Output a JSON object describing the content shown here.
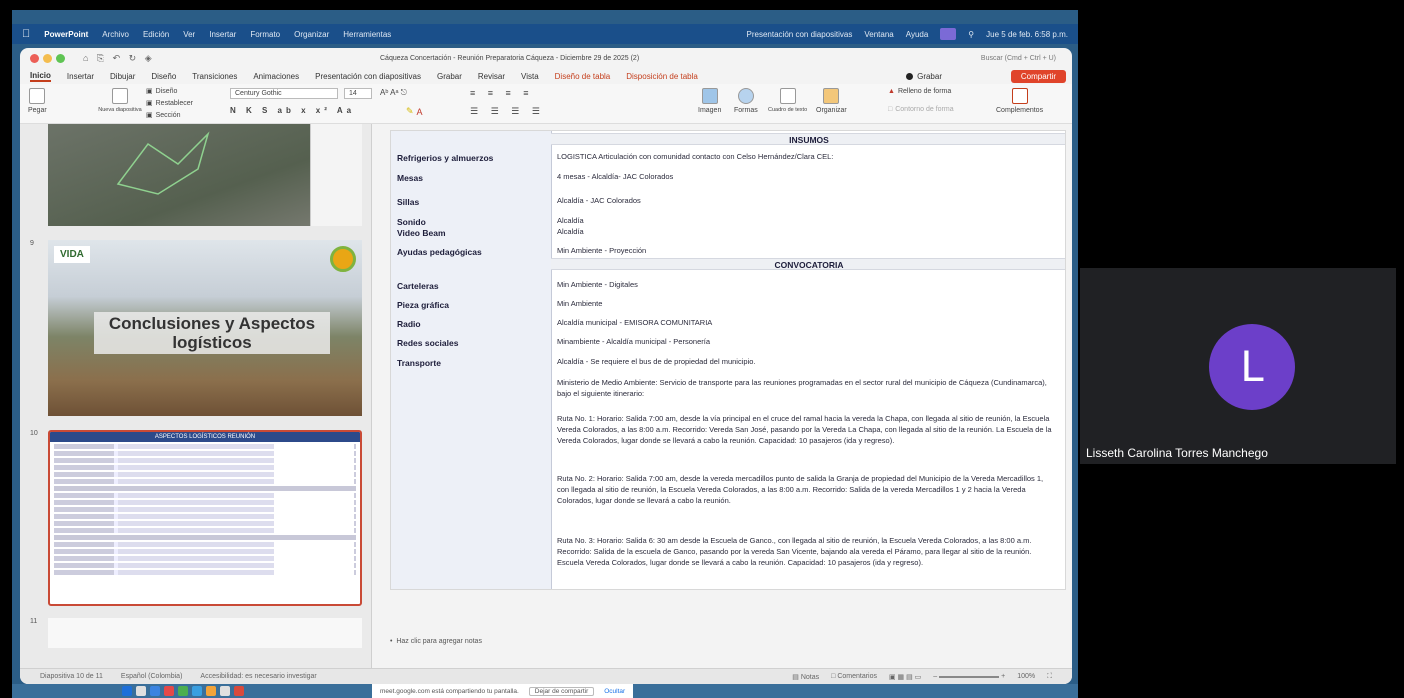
{
  "menubar": {
    "app": "PowerPoint",
    "items": [
      "Archivo",
      "Edición",
      "Ver",
      "Insertar",
      "Formato",
      "Organizar",
      "Herramientas"
    ],
    "right_items": [
      "Presentación con diapositivas",
      "Ventana",
      "Ayuda"
    ],
    "clock": "Jue 5 de feb. 6:58 p.m."
  },
  "titlebar": {
    "title": "Cáqueza Concertación - Reunión Preparatoria Cáqueza - Diciembre 29 de 2025 (2)",
    "search": "Buscar (Cmd + Ctrl + U)"
  },
  "tabs": {
    "items": [
      "Inicio",
      "Insertar",
      "Dibujar",
      "Diseño",
      "Transiciones",
      "Animaciones",
      "Presentación con diapositivas",
      "Grabar",
      "Revisar",
      "Vista"
    ],
    "context": [
      "Diseño de tabla",
      "Disposición de tabla"
    ],
    "record": "Grabar",
    "share": "Compartir"
  },
  "ribbon": {
    "paste": "Pegar",
    "new_slide": "Nueva diapositiva",
    "layout": "Diseño",
    "reset": "Restablecer",
    "section": "Sección",
    "font": "Century Gothic",
    "size": "14",
    "picture": "Imagen",
    "shapes": "Formas",
    "textbox": "Cuadro de texto",
    "arrange": "Organizar",
    "fill": "Relleno de forma",
    "outline": "Contorno de forma",
    "addins": "Complementos"
  },
  "thumbs": {
    "n9": "9",
    "n10": "10",
    "n11": "11",
    "logo": "VIDA",
    "slide9_title": "Conclusiones y Aspectos logísticos",
    "slide10_head": "ASPECTOS LOGÍSTICOS REUNIÓN"
  },
  "slide": {
    "sections": {
      "insumos": "INSUMOS",
      "convocatoria": "CONVOCATORIA"
    },
    "rows": [
      {
        "label": "Refrigerios y almuerzos",
        "value": "LOGISTICA Articulación con comunidad contacto con Celso Hernández/Clara CEL:"
      },
      {
        "label": "Mesas",
        "value": "4 mesas - Alcaldía- JAC Colorados"
      },
      {
        "label": "Sillas",
        "value": "Alcaldía - JAC Colorados"
      },
      {
        "label": "Sonido",
        "value": "Alcaldía"
      },
      {
        "label": "Video Beam",
        "value": "Alcaldía"
      },
      {
        "label": "Ayudas pedagógicas",
        "value": "Min Ambiente - Proyección"
      },
      {
        "label": "Carteleras",
        "value": "Min Ambiente - Digitales"
      },
      {
        "label": "Pieza gráfica",
        "value": "Min Ambiente"
      },
      {
        "label": "Radio",
        "value": "Alcaldía municipal - EMISORA COMUNITARIA"
      },
      {
        "label": "Redes sociales",
        "value": "Minambiente - Alcaldía municipal - Personería"
      },
      {
        "label": "Transporte",
        "value": "Alcaldía - Se requiere el bus de de propiedad del municipio."
      }
    ],
    "transport_intro": "Ministerio de Medio Ambiente: Servicio de transporte para las reuniones programadas en el sector rural del municipio de Cáqueza (Cundinamarca), bajo el siguiente itinerario:",
    "ruta1": "Ruta No. 1: Horario: Salida 7:00 am, desde la vía principal en el cruce del ramal hacia la vereda la Chapa, con llegada al sitio de reunión, la Escuela Vereda Colorados, a las 8:00 a.m. Recorrido: Vereda San José, pasando por la Vereda La Chapa, con llegada al sitio de la reunión. La Escuela de la Vereda Colorados, lugar donde se llevará a cabo la reunión. Capacidad: 10 pasajeros (ida y regreso).",
    "ruta2": "Ruta No. 2: Horario: Salida 7:00 am, desde la vereda mercadillos punto de salida la Granja de propiedad del Municipio de la Vereda Mercadillos 1, con llegada al sitio de reunión, la Escuela Vereda Colorados, a las 8:00 a.m. Recorrido: Salida de la vereda Mercadillos 1 y 2 hacia la Vereda Colorados, lugar donde se llevará a cabo la reunión.",
    "ruta3": "Ruta No. 3: Horario: Salida 6: 30 am desde la Escuela de Ganco., con llegada al sitio de reunión, la Escuela Vereda Colorados, a las 8:00 a.m. Recorrido: Salida de la escuela de Ganco, pasando por la vereda San Vicente, bajando ala vereda el Páramo, para llegar al sitio de la reunión. Escuela Vereda Colorados, lugar donde se llevará a cabo la reunión. Capacidad: 10 pasajeros (ida y regreso)."
  },
  "notes": "Haz clic para agregar notas",
  "status": {
    "slide": "Diapositiva 10 de 11",
    "lang": "Español (Colombia)",
    "access": "Accesibilidad: es necesario investigar",
    "notes": "Notas",
    "comments": "Comentarios",
    "zoom": "100%"
  },
  "sharebar": {
    "text": "meet.google.com está compartiendo tu pantalla.",
    "stop": "Dejar de compartir",
    "hide": "Ocultar"
  },
  "participant": {
    "initial": "L",
    "name": "Lisseth Carolina Torres Manchego",
    "avatar_color": "#6c3fc9"
  }
}
